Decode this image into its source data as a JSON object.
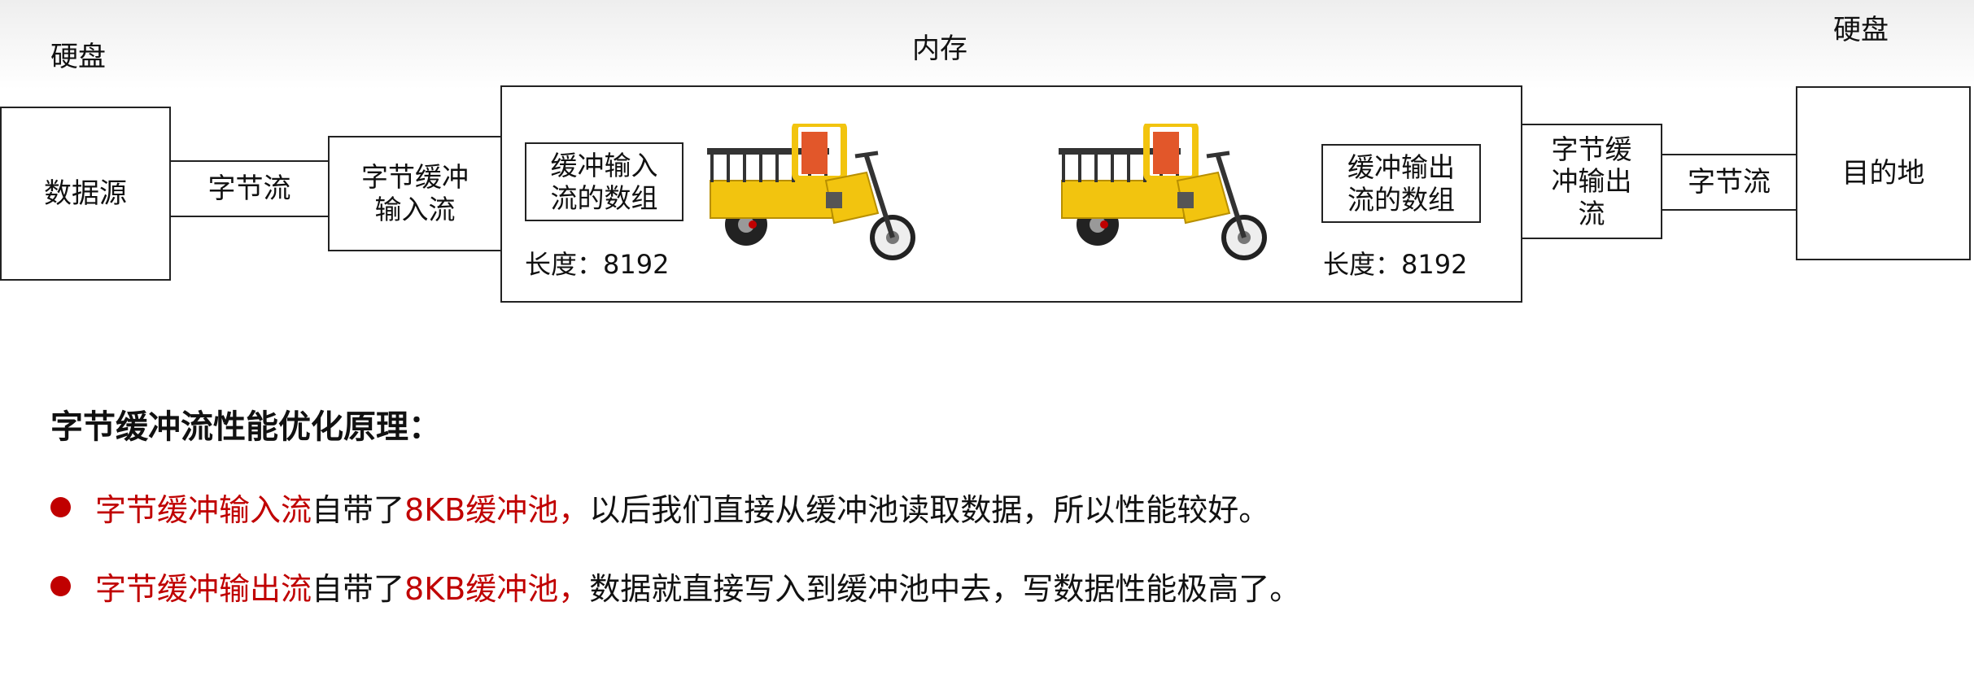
{
  "diagram": {
    "left_disk_label": "硬盘",
    "memory_label": "内存",
    "right_disk_label": "硬盘",
    "source_box": "数据源",
    "byte_stream_left": "字节流",
    "buffered_input_stream": "字节缓冲输入流",
    "input_buffer_array": "缓冲输入流的数组",
    "input_buffer_length": "长度：8192",
    "output_buffer_array": "缓冲输出流的数组",
    "output_buffer_length": "长度：8192",
    "buffered_output_stream": "字节缓冲输出流",
    "byte_stream_right": "字节流",
    "destination_box": "目的地"
  },
  "explanation": {
    "heading": "字节缓冲流性能优化原理：",
    "bullets": [
      {
        "highlight1": "字节缓冲输入流",
        "text1": "自带了",
        "highlight2": "8KB缓冲池，",
        "text2": "以后我们直接从缓冲池读取数据，所以性能较好。"
      },
      {
        "highlight1": "字节缓冲输出流",
        "text1": "自带了",
        "highlight2": "8KB缓冲池，",
        "text2": "数据就直接写入到缓冲池中去，写数据性能极高了。"
      }
    ]
  },
  "colors": {
    "highlight": "#c00000",
    "tricycle_body": "#f2c40f",
    "tricycle_panel": "#e2572a"
  },
  "icons": [
    "tricycle-image-input",
    "tricycle-image-output"
  ]
}
